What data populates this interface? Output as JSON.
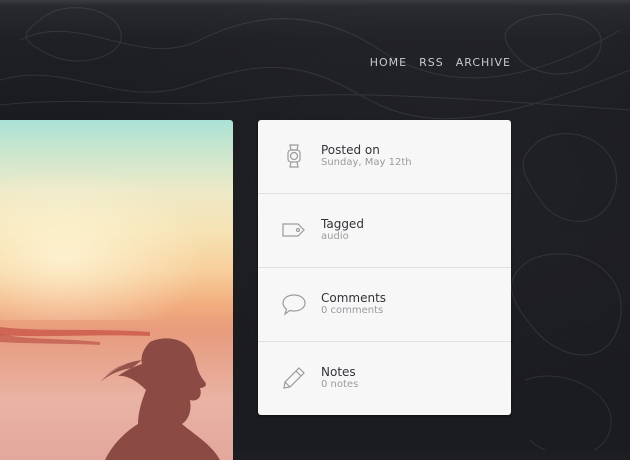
{
  "nav": {
    "items": [
      "HOME",
      "RSS",
      "ARCHIVE"
    ]
  },
  "post_meta": [
    {
      "icon": "watch-icon",
      "title": "Posted on",
      "value": "Sunday, May 12th"
    },
    {
      "icon": "tag-icon",
      "title": "Tagged",
      "value": "audio"
    },
    {
      "icon": "speech-bubble-icon",
      "title": "Comments",
      "value": "0 comments"
    },
    {
      "icon": "pencil-icon",
      "title": "Notes",
      "value": "0 notes"
    }
  ],
  "colors": {
    "background": "#1d1e22",
    "panel": "#f7f7f7",
    "nav_text": "#c9cace",
    "title_text": "#333438",
    "sub_text": "#9a9b9f"
  }
}
